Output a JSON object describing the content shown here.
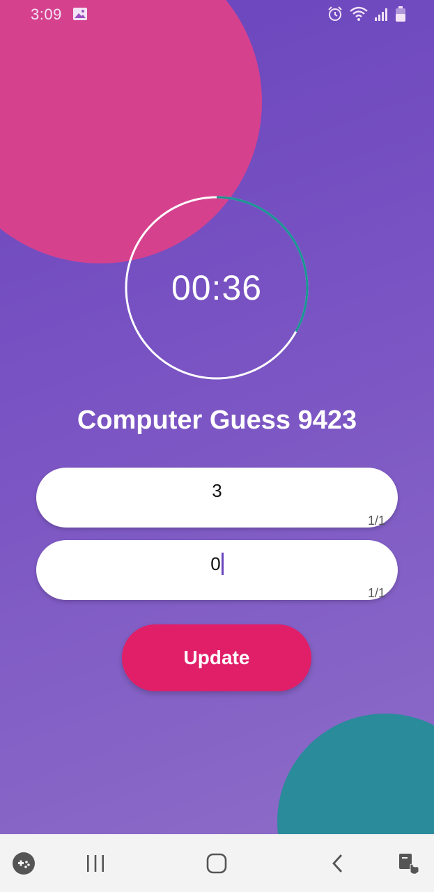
{
  "status_bar": {
    "time": "3:09",
    "icons": [
      "image-icon",
      "alarm-icon",
      "wifi-icon",
      "signal-icon",
      "battery-icon"
    ]
  },
  "timer": {
    "display": "00:36",
    "progress": 0.33,
    "colors": {
      "track": "#ffffff",
      "progress": "#179691"
    }
  },
  "title": "Computer Guess 9423",
  "fields": [
    {
      "value": "3",
      "counter": "1/1"
    },
    {
      "value": "0",
      "counter": "1/1"
    }
  ],
  "update_button": {
    "label": "Update",
    "color": "#e01f68"
  },
  "nav_bar": {
    "items": [
      "game-launcher-icon",
      "recent-apps-icon",
      "home-icon",
      "back-icon",
      "assistant-touch-icon"
    ]
  },
  "colors": {
    "background_top": "#6a45bd",
    "background_bottom": "#8c6cc8",
    "pink_blob": "#d6418e",
    "teal_blob": "#2a8b9a"
  }
}
